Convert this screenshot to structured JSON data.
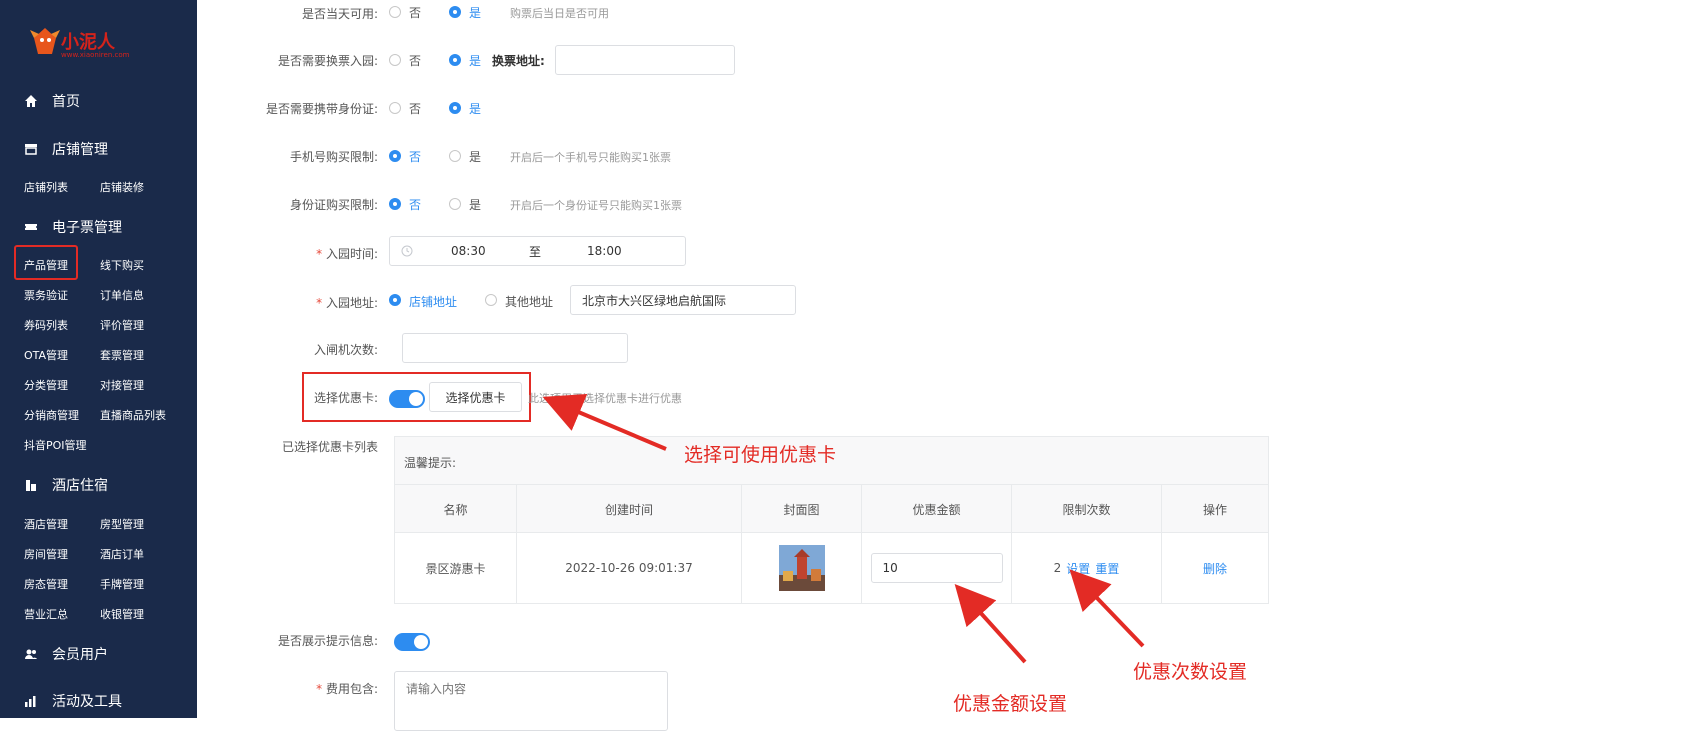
{
  "sidebar": {
    "logo_text": "小泥人",
    "logo_sub": "www.xiaoniren.com",
    "main_items": [
      {
        "label": "首页",
        "icon": "home-icon"
      },
      {
        "label": "店铺管理",
        "icon": "store-icon"
      },
      {
        "label": "电子票管理",
        "icon": "ticket-icon"
      },
      {
        "label": "酒店住宿",
        "icon": "hotel-icon"
      },
      {
        "label": "会员用户",
        "icon": "users-icon"
      },
      {
        "label": "活动及工具",
        "icon": "chart-icon"
      }
    ],
    "store_sub": [
      "店铺列表",
      "店铺装修"
    ],
    "ticket_sub": [
      "产品管理",
      "线下购买",
      "票务验证",
      "订单信息",
      "券码列表",
      "评价管理",
      "OTA管理",
      "套票管理",
      "分类管理",
      "对接管理",
      "分销商管理",
      "直播商品列表",
      "抖音POI管理"
    ],
    "hotel_sub": [
      "酒店管理",
      "房型管理",
      "房间管理",
      "酒店订单",
      "房态管理",
      "手牌管理",
      "营业汇总",
      "收银管理"
    ]
  },
  "form": {
    "same_day": {
      "label": "是否当天可用",
      "opt_no": "否",
      "opt_yes": "是",
      "selected": "yes",
      "hint": "购票后当日是否可用"
    },
    "exchange": {
      "label": "是否需要换票入园",
      "opt_no": "否",
      "opt_yes": "是",
      "selected": "yes",
      "addr_label": "换票地址",
      "addr_value": ""
    },
    "id_card": {
      "label": "是否需要携带身份证",
      "opt_no": "否",
      "opt_yes": "是",
      "selected": "yes"
    },
    "phone_limit": {
      "label": "手机号购买限制",
      "opt_no": "否",
      "opt_yes": "是",
      "selected": "no",
      "hint": "开启后一个手机号只能购买1张票"
    },
    "idcard_limit": {
      "label": "身份证购买限制",
      "opt_no": "否",
      "opt_yes": "是",
      "selected": "no",
      "hint": "开启后一个身份证号只能购买1张票"
    },
    "entry_time": {
      "label": "入园时间",
      "start": "08:30",
      "sep": "至",
      "end": "18:00"
    },
    "entry_addr": {
      "label": "入园地址",
      "opt_store": "店铺地址",
      "opt_other": "其他地址",
      "selected": "store",
      "value": "北京市大兴区绿地启航国际"
    },
    "gate_count": {
      "label": "入闸机次数",
      "value": ""
    },
    "coupon": {
      "label": "选择优惠卡",
      "button": "选择优惠卡",
      "hint": "此选项用于选择优惠卡进行优惠",
      "enabled": true
    },
    "coupon_list": {
      "label": "已选择优惠卡列表",
      "hint": "温馨提示:",
      "columns": [
        "名称",
        "创建时间",
        "封面图",
        "优惠金额",
        "限制次数",
        "操作"
      ],
      "rows": [
        {
          "name": "景区游惠卡",
          "created": "2022-10-26 09:01:37",
          "amount": "10",
          "limit": "2",
          "set": "设置",
          "reset": "重置",
          "delete": "删除"
        }
      ]
    },
    "show_tip": {
      "label": "是否展示提示信息",
      "enabled": true
    },
    "fee": {
      "label": "费用包含",
      "placeholder": "请输入内容"
    }
  },
  "annotations": {
    "select_card": "选择可使用优惠卡",
    "amount": "优惠金额设置",
    "limit": "优惠次数设置",
    "color": "#e32b25"
  },
  "colors": {
    "sidebar_bg": "#1a2a4a",
    "accent": "#2d8cf0",
    "highlight": "#e32b25"
  }
}
